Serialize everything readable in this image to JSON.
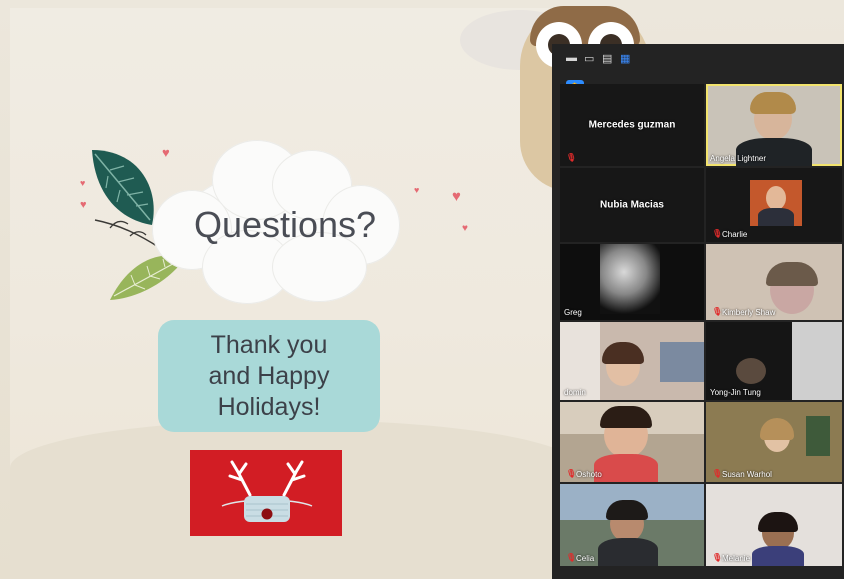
{
  "slide": {
    "cloud_text": "Questions?",
    "thanks_lines": [
      "Thank you",
      "and Happy",
      "Holidays!"
    ]
  },
  "zoom": {
    "toolbar_icons": [
      "minimize-icon",
      "gallery-view-icon",
      "speaker-view-icon",
      "grid-view-icon"
    ],
    "raise_hand_icon": "hand-icon",
    "participants": [
      {
        "name": "Mercedes guzman",
        "muted": true,
        "video": false
      },
      {
        "name": "Angela Lightner",
        "muted": false,
        "video": true
      },
      {
        "name": "Nubia Macias",
        "muted": false,
        "video": false
      },
      {
        "name": "Charlie",
        "muted": true,
        "video": true
      },
      {
        "name": "Greg",
        "muted": false,
        "video": true
      },
      {
        "name": "Kimberly Shaw",
        "muted": true,
        "video": true
      },
      {
        "name": "domin",
        "muted": false,
        "video": true
      },
      {
        "name": "Yong-Jin Tung",
        "muted": false,
        "video": true
      },
      {
        "name": "Oshoto",
        "muted": true,
        "video": true
      },
      {
        "name": "Susan Warhol",
        "muted": true,
        "video": true
      },
      {
        "name": "Celia",
        "muted": true,
        "video": true
      },
      {
        "name": "Melanie",
        "muted": true,
        "video": true
      }
    ]
  },
  "colors": {
    "thanks_box": "#a9d9d8",
    "reindeer_bg": "#d21d24",
    "zoom_bg": "#232323",
    "active_speaker": "#f2e36d"
  }
}
